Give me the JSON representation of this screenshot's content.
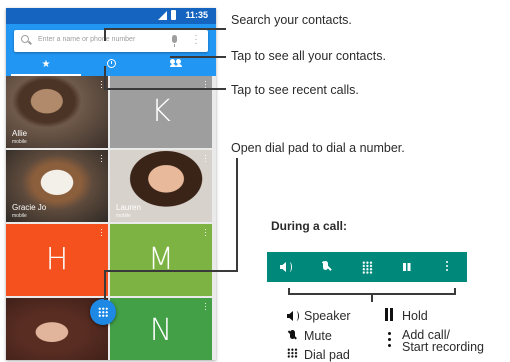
{
  "phone": {
    "status_time": "11:35",
    "search_placeholder": "Enter a name or phone number",
    "tabs": [
      {
        "icon": "star-icon",
        "active": true
      },
      {
        "icon": "clock-icon",
        "active": false
      },
      {
        "icon": "group-icon",
        "active": false
      }
    ],
    "contacts": [
      {
        "name": "Allie",
        "sub": "mobile"
      },
      {
        "letter": "K",
        "color": "#9e9e9e"
      },
      {
        "name": "Gracie Jo",
        "sub": "mobile"
      },
      {
        "name": "Lauren",
        "sub": "mobile"
      },
      {
        "letter": "H",
        "color": "#f4511e"
      },
      {
        "letter": "M",
        "color": "#7cb342"
      },
      {
        "letter": "N",
        "color": "#43a047"
      }
    ]
  },
  "callouts": {
    "search": "Search your contacts.",
    "all_contacts": "Tap to see all your contacts.",
    "recent": "Tap to see recent calls.",
    "dialpad": "Open dial pad to dial a number."
  },
  "during_call": {
    "title": "During a call:",
    "bar_color": "#00897b",
    "buttons": [
      "speaker-icon",
      "mute-icon",
      "dialpad-icon",
      "hold-icon",
      "more-icon"
    ]
  },
  "legend": {
    "speaker": "Speaker",
    "mute": "Mute",
    "dialpad": "Dial pad",
    "hold": "Hold",
    "add_call_1": "Add call/",
    "add_call_2": "Start recording"
  }
}
